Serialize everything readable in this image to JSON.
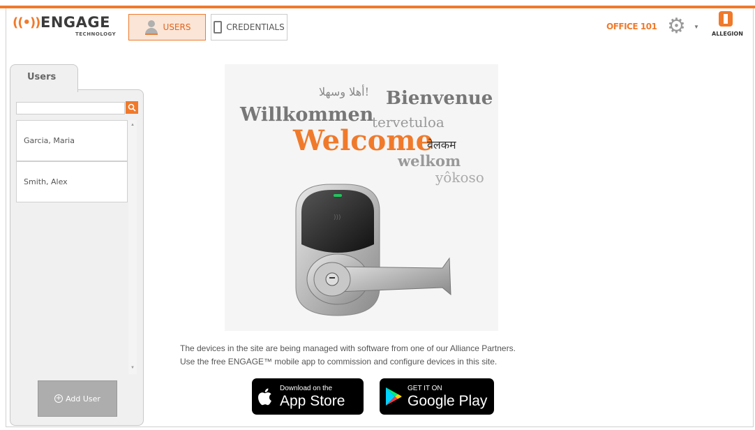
{
  "header": {
    "logo_word": "ENGAGE",
    "logo_sub": "TECHNOLOGY",
    "nav": {
      "users_label": "USERS",
      "credentials_label": "CREDENTIALS"
    },
    "site_name": "OFFICE 101",
    "brand": "ALLEGION"
  },
  "sidebar": {
    "tab_label": "Users",
    "search": {
      "value": "",
      "placeholder": ""
    },
    "users": [
      {
        "name": "Garcia, Maria"
      },
      {
        "name": "Smith, Alex"
      }
    ],
    "add_user_label": "Add User"
  },
  "welcome": {
    "words": {
      "arabic": "أهلا وسهلا!",
      "french": "Bienvenue",
      "german": "Willkommen",
      "finnish": "tervetuloa",
      "english": "Welcome",
      "hindi": "वेलकम",
      "dutch": "welkom",
      "japanese": "yôkoso"
    }
  },
  "info": {
    "line1": "The devices in the site are being managed with software from one of our Alliance Partners.",
    "line2": "Use the free ENGAGE™ mobile app to commission and configure devices in this site."
  },
  "stores": {
    "apple": {
      "small": "Download on the",
      "big": "App Store"
    },
    "google": {
      "small": "GET IT ON",
      "big": "Google Play"
    }
  },
  "colors": {
    "accent": "#f07a2b",
    "panel": "#f0f0f0"
  }
}
